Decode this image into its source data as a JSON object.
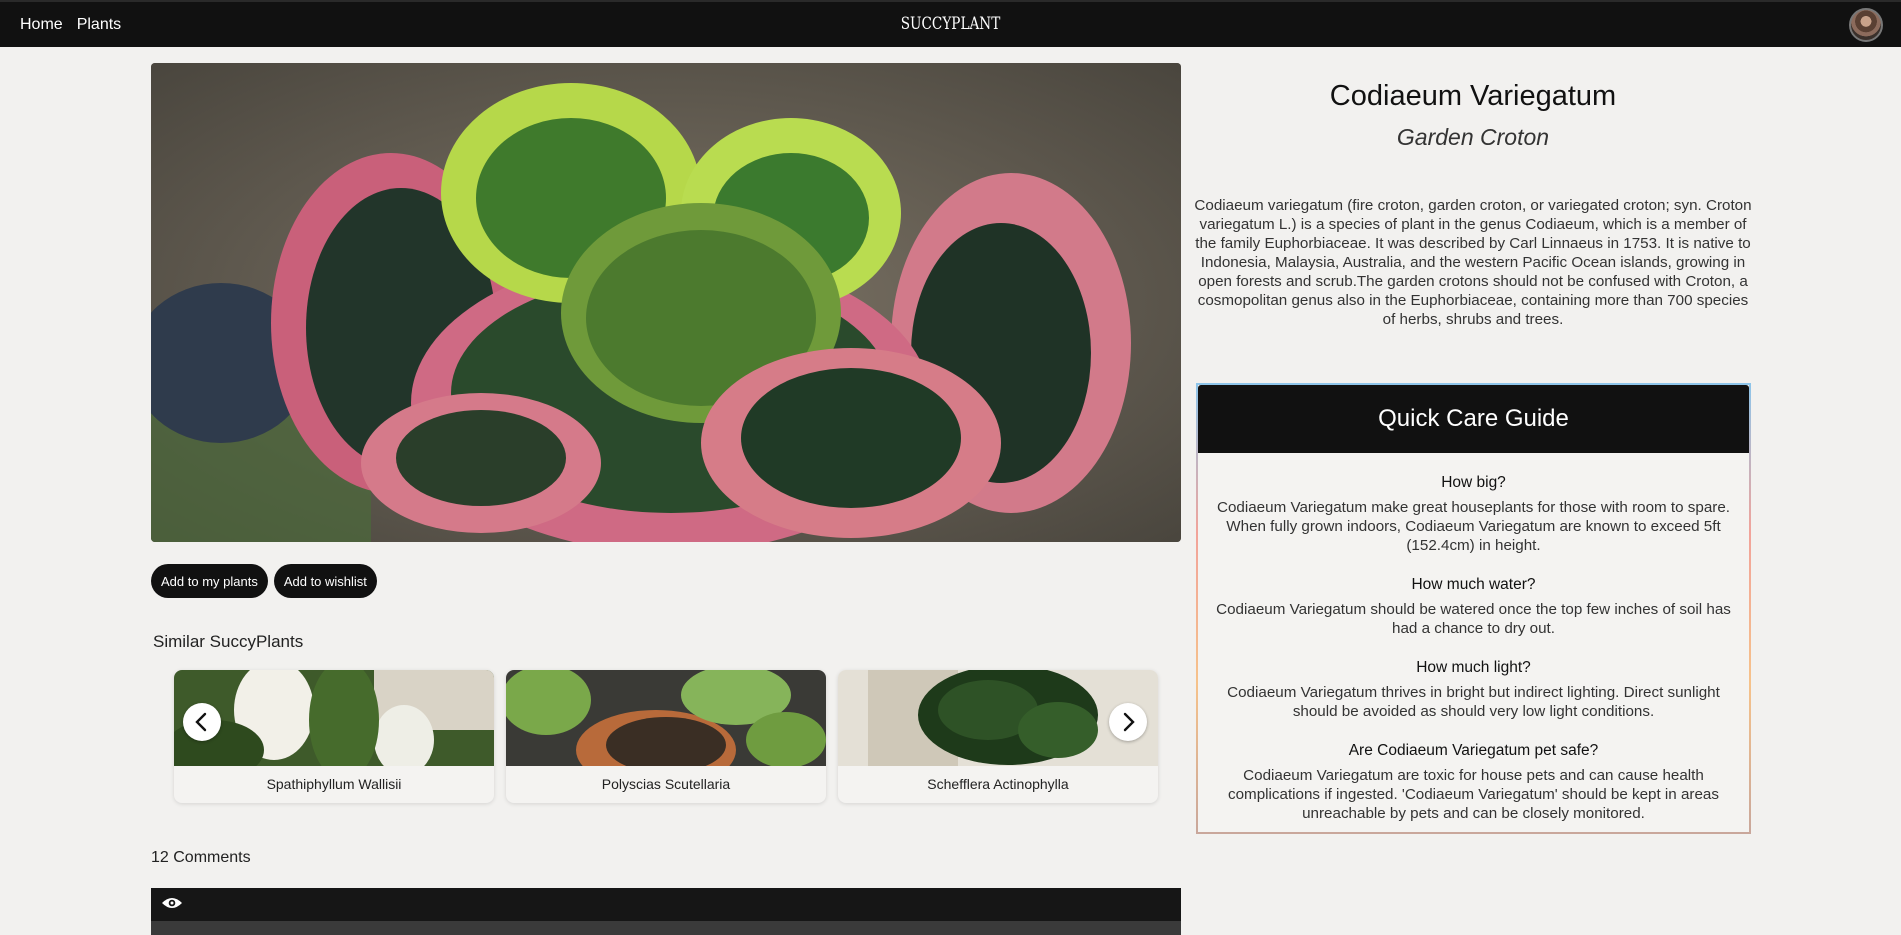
{
  "nav": {
    "home": "Home",
    "plants": "Plants",
    "brand": "SUCCYPLANT"
  },
  "plant": {
    "name": "Codiaeum Variegatum",
    "common_name": "Garden Croton",
    "description": "Codiaeum variegatum (fire croton, garden croton, or variegated croton; syn. Croton variegatum L.) is a species of plant in the genus Codiaeum, which is a member of the family Euphorbiaceae. It was described by Carl Linnaeus in 1753. It is native to Indonesia, Malaysia, Australia, and the western Pacific Ocean islands, growing in open forests and scrub.The garden crotons should not be confused with Croton, a cosmopolitan genus also in the Euphorbiaceae, containing more than 700 species of herbs, shrubs and trees."
  },
  "actions": {
    "add_my_plants": "Add to my plants",
    "add_wishlist": "Add to wishlist"
  },
  "similar": {
    "title": "Similar SuccyPlants",
    "items": [
      {
        "label": "Spathiphyllum Wallisii"
      },
      {
        "label": "Polyscias Scutellaria"
      },
      {
        "label": "Schefflera Actinophylla"
      }
    ]
  },
  "comments": {
    "count_label": "12 Comments"
  },
  "care": {
    "title": "Quick Care Guide",
    "items": [
      {
        "q": "How big?",
        "a": "Codiaeum Variegatum make great houseplants for those with room to spare. When fully grown indoors, Codiaeum Variegatum are known to exceed 5ft (152.4cm) in height."
      },
      {
        "q": "How much water?",
        "a": "Codiaeum Variegatum should be watered once the top few inches of soil has had a chance to dry out."
      },
      {
        "q": "How much light?",
        "a": "Codiaeum Variegatum thrives in bright but indirect lighting. Direct sunlight should be avoided as should very low light conditions."
      },
      {
        "q": "Are Codiaeum Variegatum pet safe?",
        "a": "Codiaeum Variegatum are toxic for house pets and can cause health complications if ingested. 'Codiaeum Variegatum' should be kept in areas unreachable by pets and can be closely monitored."
      }
    ]
  },
  "icons": {
    "prev": "chevron-left-icon",
    "next": "chevron-right-icon",
    "eye": "eye-icon",
    "avatar": "user-avatar"
  }
}
